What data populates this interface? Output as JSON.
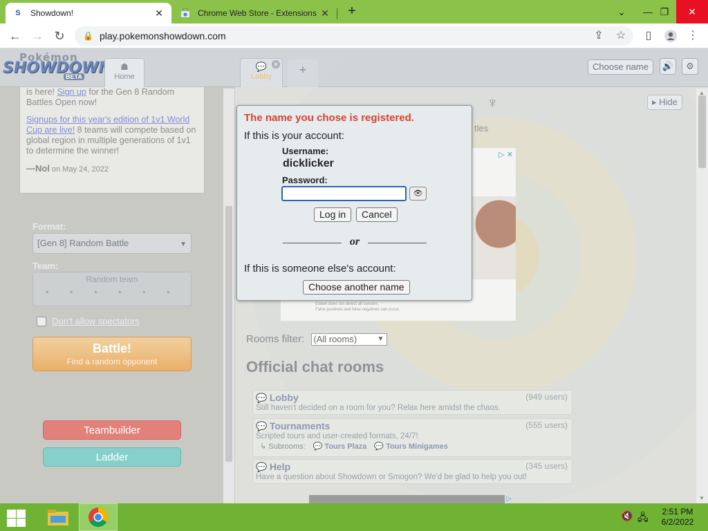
{
  "browser": {
    "tabs": [
      {
        "title": "Showdown!",
        "favicon": "S"
      },
      {
        "title": "Chrome Web Store - Extensions",
        "favicon": "store"
      }
    ],
    "url": "play.pokemonshowdown.com"
  },
  "header": {
    "logo_line1": "Pokémon",
    "logo_line2": "SHOWDOWN",
    "logo_badge": "BETA",
    "home_tab": "Home",
    "lobby_tab": "Lobby",
    "choose_name": "Choose name"
  },
  "news": {
    "p1_pre": "is here! ",
    "p1_link": "Sign up",
    "p1_post": " for the Gen 8 Random Battles Open now!",
    "p2_link": "Signups for this year's edition of 1v1 World Cup are live!",
    "p2_post": " 8 teams will compete based on global region in multiple generations of 1v1 to determine the winner!",
    "author": "—Nol",
    "date": "on May 24, 2022"
  },
  "left": {
    "format_label": "Format:",
    "format_value": "[Gen 8] Random Battle",
    "team_label": "Team:",
    "team_value": "Random team",
    "spectators": "Don't allow spectators",
    "battle": "Battle!",
    "battle_sub": "Find a random opponent",
    "teambuilder": "Teambuilder",
    "ladder": "Ladder"
  },
  "right": {
    "hide": "Hide",
    "rooms_filter_label": "Rooms filter:",
    "rooms_filter_value": "(All rooms)",
    "official_title": "Official chat rooms",
    "ad_fineprint_1": "Galleri does not detect all cancers.",
    "ad_fineprint_2": "False positives and false negatives can occur.",
    "peek_text": "tles",
    "rooms": [
      {
        "name": "Lobby",
        "users": "(949 users)",
        "desc": "Still haven't decided on a room for you? Relax here amidst the chaos."
      },
      {
        "name": "Tournaments",
        "users": "(555 users)",
        "desc": "Scripted tours and user-created formats, 24/7!",
        "subrooms_label": "Subrooms:",
        "subrooms": [
          "Tours Plaza",
          "Tours Minigames"
        ]
      },
      {
        "name": "Help",
        "users": "(345 users)",
        "desc": "Have a question about Showdown or Smogon? We'd be glad to help you out!"
      }
    ]
  },
  "modal": {
    "warning": "The name you chose is registered.",
    "your_account": "If this is your account:",
    "username_label": "Username:",
    "username": "dicklicker",
    "password_label": "Password:",
    "password_value": "",
    "login": "Log in",
    "cancel": "Cancel",
    "or": "or",
    "someone_else": "If this is someone else's account:",
    "choose_another": "Choose another name"
  },
  "taskbar": {
    "time": "2:51 PM",
    "date": "6/2/2022"
  }
}
